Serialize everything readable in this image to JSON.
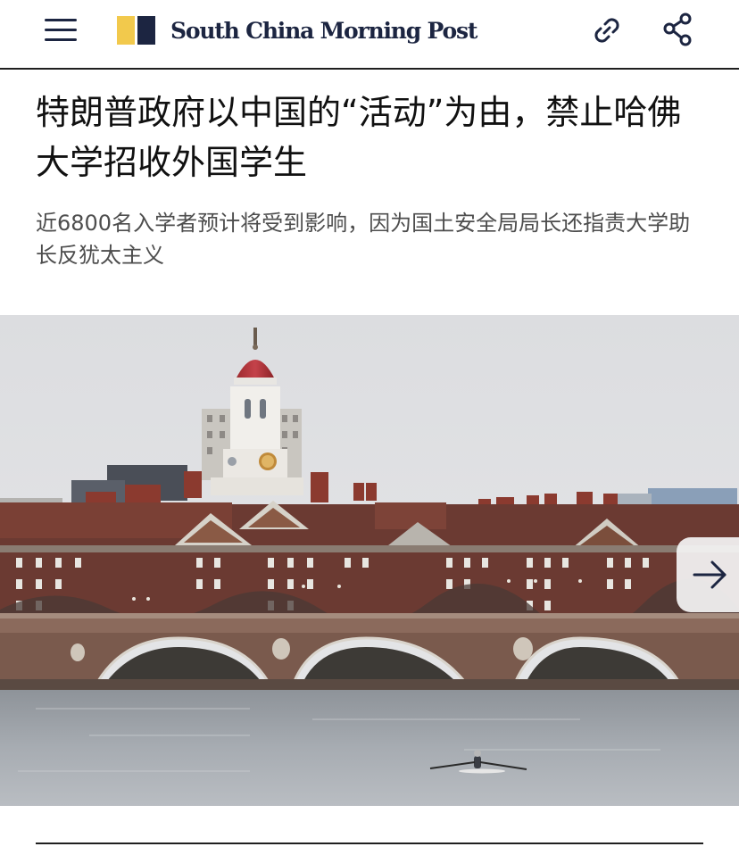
{
  "header": {
    "brand": "South China Morning Post",
    "logo_colors": {
      "yellow": "#f2c94c",
      "navy": "#1c2541"
    },
    "menu_icon": "hamburger-menu-icon",
    "link_icon": "link-icon",
    "share_icon": "share-icon"
  },
  "article": {
    "headline": "特朗普政府以中国的“活动”为由，禁止哈佛大学招收外国学生",
    "subhead": "近6800名入学者预计将受到影响，因为国土安全局局长还指责大学助长反犹太主义"
  },
  "media": {
    "next_icon": "arrow-right-icon"
  }
}
